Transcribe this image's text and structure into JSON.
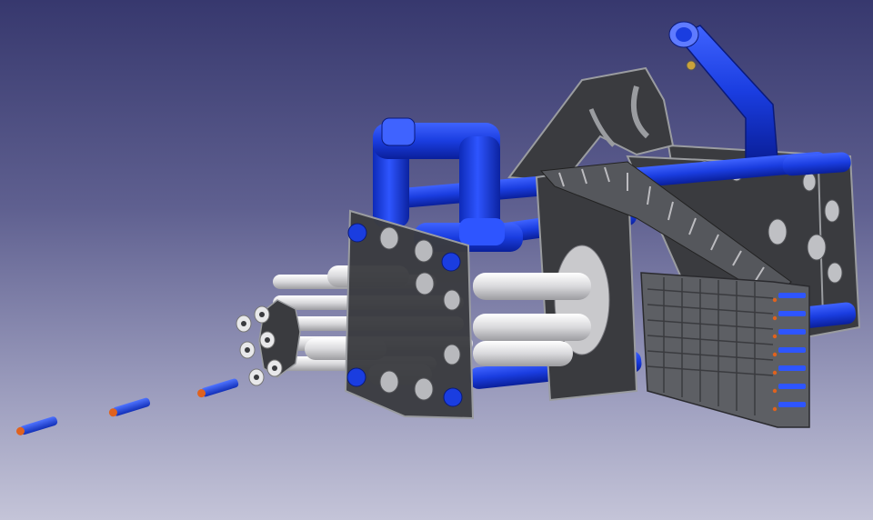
{
  "viewport": {
    "background_top": "#37386e",
    "background_bottom": "#c4c4d8"
  },
  "model": {
    "colors": {
      "frame_plate": "#3a3b3f",
      "frame_edge": "#9a9ca0",
      "pvc_blue": "#1a3de0",
      "pvc_blue_highlight": "#5f7bff",
      "barrel_white": "#e8e8ea",
      "magazine_gray": "#6d6f73",
      "dart_tip": "#e0621e"
    },
    "parts": [
      "front-frame-plate",
      "rear-frame-plates",
      "air-pipe-assembly",
      "barrel-cluster",
      "ammo-belt",
      "dart-magazine",
      "projectile-darts"
    ]
  }
}
